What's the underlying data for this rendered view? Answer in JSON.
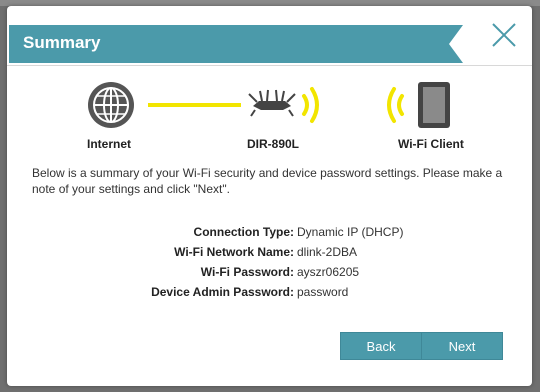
{
  "dialog": {
    "title": "Summary",
    "accent_color": "#4b9aaa"
  },
  "topology": {
    "internet_label": "Internet",
    "router_label": "DIR-890L",
    "client_label": "Wi-Fi Client",
    "link_color": "#f2e500",
    "icons": [
      "globe-icon",
      "router-icon",
      "wifi-waves-icon",
      "tablet-icon"
    ]
  },
  "description": "Below is a summary of your Wi-Fi security and device password settings. Please make a note of your settings and click \"Next\".",
  "summary": [
    {
      "label": "Connection Type:",
      "value": "Dynamic IP (DHCP)"
    },
    {
      "label": "Wi-Fi Network Name:",
      "value": "dlink-2DBA"
    },
    {
      "label": "Wi-Fi Password:",
      "value": "ayszr06205"
    },
    {
      "label": "Device Admin Password:",
      "value": "password"
    }
  ],
  "buttons": {
    "back": "Back",
    "next": "Next"
  }
}
